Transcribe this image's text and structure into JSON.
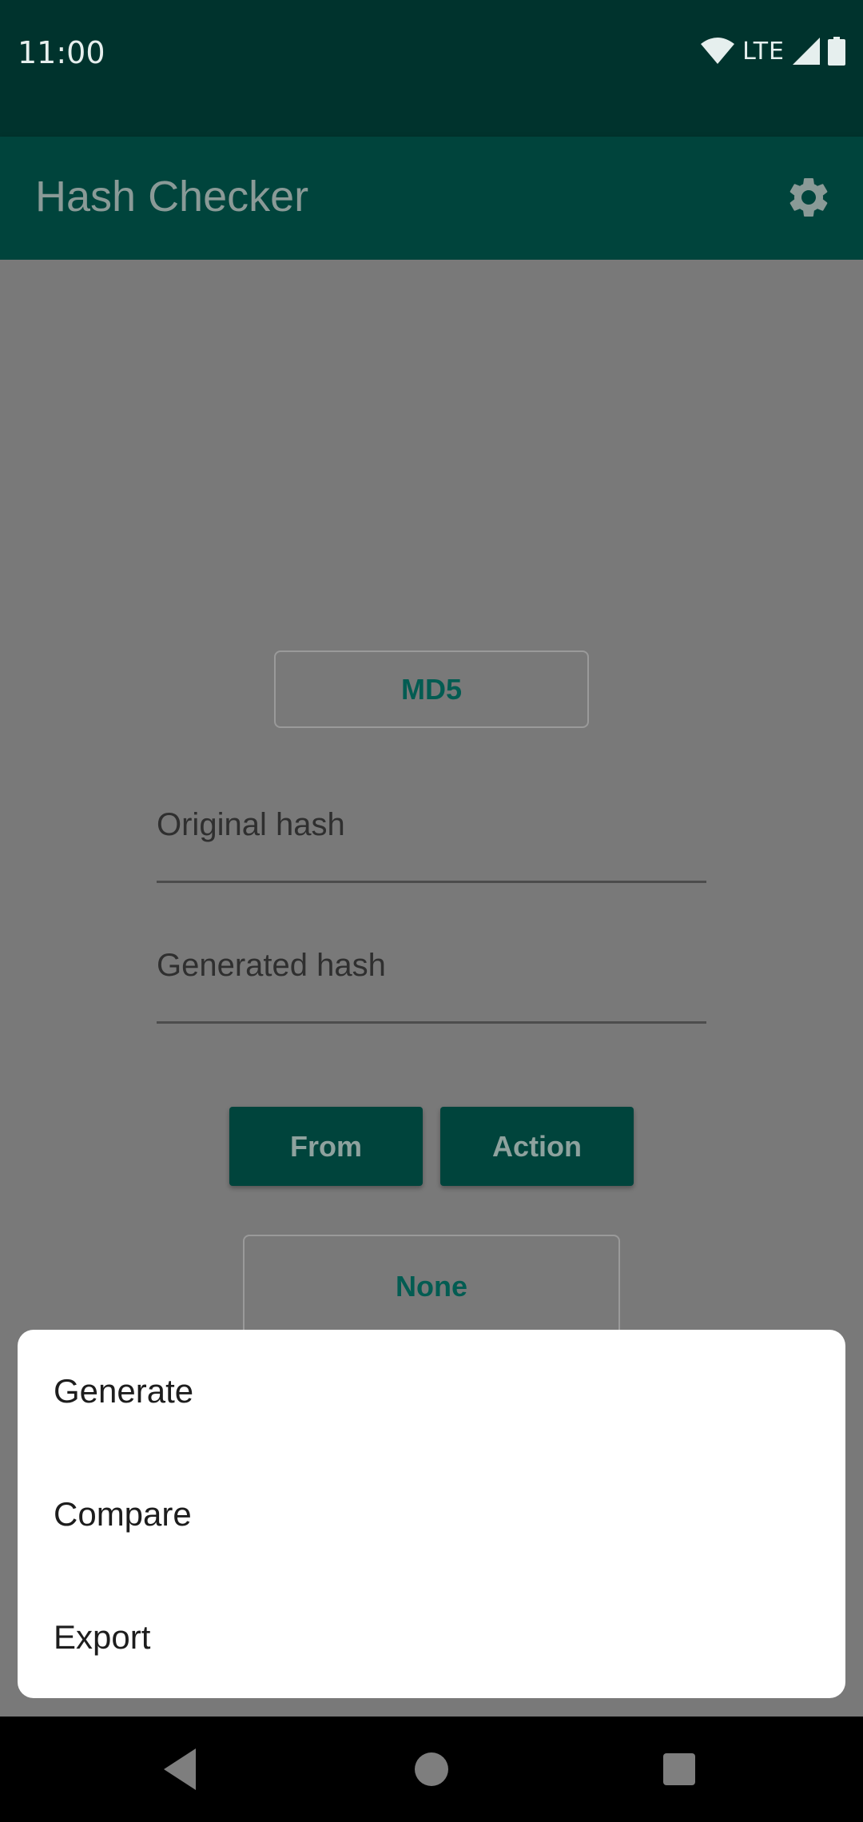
{
  "status_bar": {
    "time": "11:00",
    "network": "LTE",
    "icons": [
      "wifi-icon",
      "cell-signal-icon",
      "battery-icon"
    ]
  },
  "app_bar": {
    "title": "Hash Checker",
    "settings_icon": "gear-icon"
  },
  "main": {
    "hash_type_button": "MD5",
    "original_hash_hint": "Original hash",
    "generated_hash_hint": "Generated hash",
    "from_button": "From",
    "action_button": "Action",
    "compare_result_button": "None"
  },
  "action_sheet": {
    "items": [
      {
        "label": "Generate"
      },
      {
        "label": "Compare"
      },
      {
        "label": "Export"
      }
    ]
  },
  "colors": {
    "status_bar_bg": "#00332d",
    "app_bar_bg": "#00443c",
    "accent_text": "#035c52",
    "scrim": "#797979"
  },
  "nav_bar": {
    "icons": [
      "back-icon",
      "home-icon",
      "recents-icon"
    ]
  }
}
